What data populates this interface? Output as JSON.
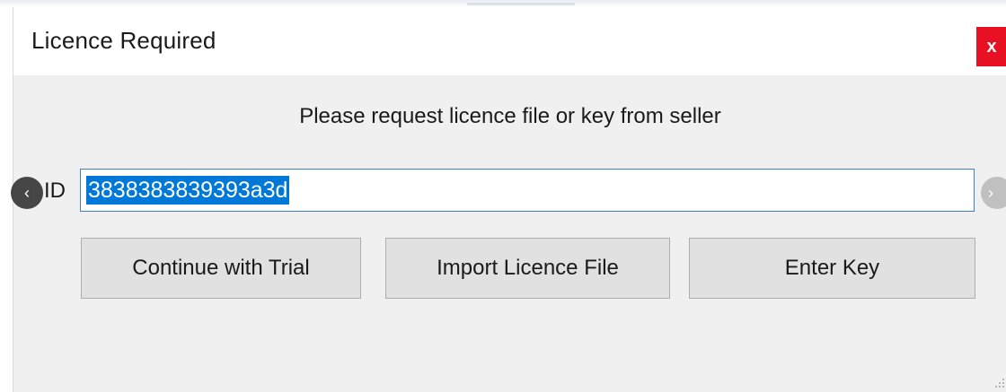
{
  "window": {
    "title": "Licence Required",
    "close_label": "x"
  },
  "message": "Please request licence file or key from seller",
  "id_field": {
    "label": "ID",
    "value": "3838383839393a3d"
  },
  "buttons": {
    "continue_trial": "Continue with Trial",
    "import_licence": "Import Licence File",
    "enter_key": "Enter Key"
  },
  "carousel": {
    "prev_icon": "‹",
    "next_icon": "›"
  },
  "colors": {
    "close_button": "#e81123",
    "selection": "#0078d7",
    "field_border": "#3c7fc4"
  }
}
